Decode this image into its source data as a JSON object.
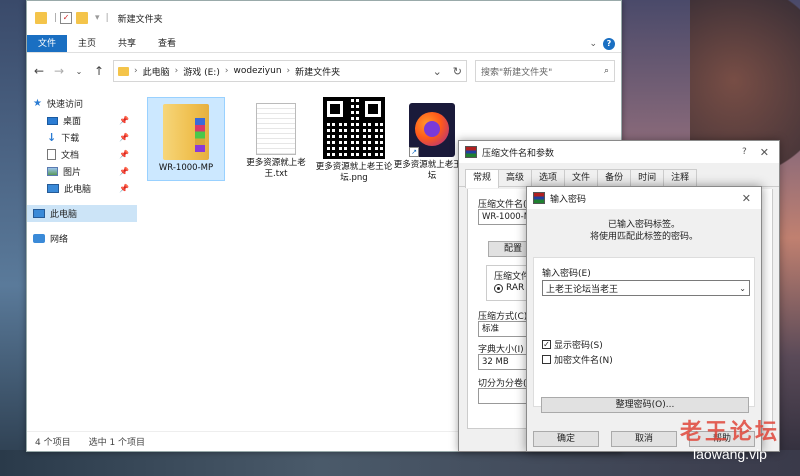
{
  "explorer": {
    "title": "新建文件夹",
    "ribbon_tabs": [
      "文件",
      "主页",
      "共享",
      "查看"
    ],
    "address": [
      "此电脑",
      "游戏 (E:)",
      "wodeziyun",
      "新建文件夹"
    ],
    "search_placeholder": "搜索\"新建文件夹\"",
    "nav": {
      "quick_access": "快速访问",
      "items": [
        "桌面",
        "下载",
        "文档",
        "图片",
        "此电脑"
      ],
      "this_pc": "此电脑",
      "network": "网络"
    },
    "files": [
      "WR-1000-MP",
      "更多资源就上老王.txt",
      "更多资源就上老王论坛.png",
      "更多资源就上老王论坛"
    ],
    "status": {
      "count": "4 个项目",
      "selected": "选中 1 个项目"
    }
  },
  "rar_dialog": {
    "title": "压缩文件名和参数",
    "help": "?",
    "tabs": [
      "常规",
      "高级",
      "选项",
      "文件",
      "备份",
      "时间",
      "注释"
    ],
    "archive_name_label": "压缩文件名(A",
    "archive_name_value": "WR-1000-MP.",
    "config_button": "配置",
    "format_label": "压缩文件格",
    "format_rar": "RAR",
    "method_label": "压缩方式(C)",
    "method_value": "标准",
    "dict_label": "字典大小(I)",
    "dict_value": "32 MB",
    "split_label": "切分为分卷("
  },
  "pwd_dialog": {
    "title": "输入密码",
    "message_line1": "已输入密码标签。",
    "message_line2": "将使用匹配此标签的密码。",
    "field_label": "输入密码(E)",
    "password_value": "上老王论坛当老王",
    "show_password": "显示密码(S)",
    "show_password_checked": true,
    "encrypt_names": "加密文件名(N)",
    "encrypt_names_checked": false,
    "organize_button": "整理密码(O)...",
    "ok": "确定",
    "cancel": "取消",
    "help": "帮助"
  },
  "watermark": {
    "cn": "老王论坛",
    "en": "laowang.vip"
  }
}
